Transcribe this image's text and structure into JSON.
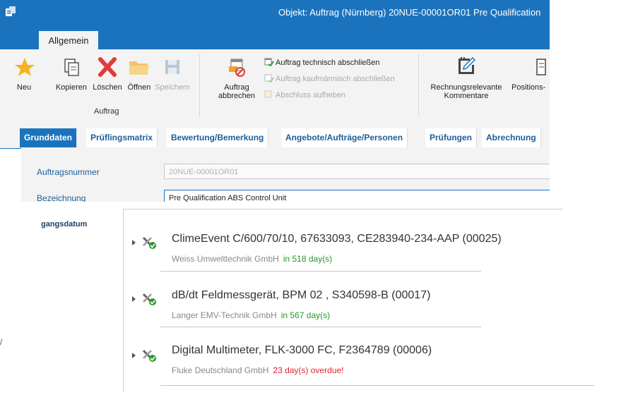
{
  "window": {
    "title": "Objekt:  Auftrag (Nürnberg) 20NUE-00001OR01 Pre Qualification",
    "ribbon_tab": "Allgemein"
  },
  "ribbon": {
    "buttons": [
      {
        "label": "Neu",
        "icon": "star-icon"
      },
      {
        "label": "Kopieren",
        "icon": "copy-icon"
      },
      {
        "label": "Löschen",
        "icon": "delete-x-icon"
      },
      {
        "label": "Öffnen",
        "icon": "folder-icon"
      },
      {
        "label": "Speichern",
        "icon": "save-icon"
      }
    ],
    "group_label": "Auftrag",
    "cancel_label_1": "Auftrag",
    "cancel_label_2": "abbrechen",
    "small_actions": [
      {
        "label": "Auftrag technisch abschließen",
        "enabled": true
      },
      {
        "label": "Auftrag kaufmännisch abschließen",
        "enabled": false
      },
      {
        "label": "Abschluss aufheben",
        "enabled": false
      }
    ],
    "comments_label_1": "Rechnungsrelevante",
    "comments_label_2": "Kommentare",
    "positions_label": "Positions-"
  },
  "content_tabs": [
    "Grunddaten",
    "Prüflingsmatrix",
    "Bewertung/Bemerkung",
    "Angebote/Aufträge/Personen",
    "Prüfungen",
    "Abrechnung"
  ],
  "form": {
    "order_number_label": "Auftragsnummer",
    "order_number_value": "20NUE-00001OR01",
    "name_label": "Bezeichnung",
    "name_value": "Pre Qualification ABS Control Unit",
    "partial_label": "gangsdatum"
  },
  "devices": [
    {
      "title": "ClimeEvent C/600/70/10, 67633093, CE283940-234-AAP (00025)",
      "maker": "Weiss Umwelttechnik GmbH",
      "due": "in 518 day(s)",
      "overdue": false
    },
    {
      "title": "dB/dt Feldmessgerät, BPM 02 , S340598-B (00017)",
      "maker": "Langer EMV-Technik GmbH",
      "due": "in 567 day(s)",
      "overdue": false
    },
    {
      "title": "Digital Multimeter, FLK-3000 FC, F2364789 (00006)",
      "maker": "Fluke Deutschland GmbH",
      "due": "23 day(s) overdue!",
      "overdue": true
    }
  ],
  "colors": {
    "accent": "#1c73bd",
    "ok": "#27952a",
    "overdue": "#e0242b"
  }
}
